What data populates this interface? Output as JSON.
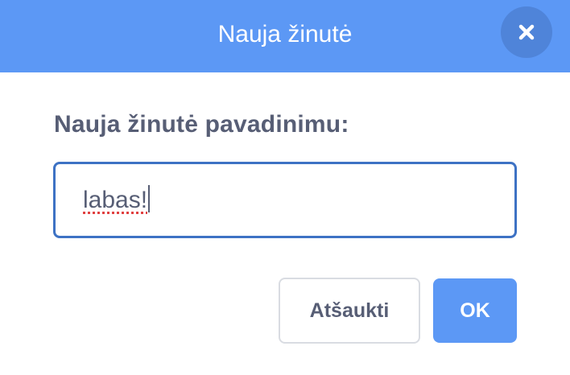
{
  "dialog": {
    "title": "Nauja žinutė",
    "close_icon": "close-icon"
  },
  "form": {
    "label": "Nauja žinutė pavadinimu:",
    "input_value": "labas!"
  },
  "buttons": {
    "cancel_label": "Atšaukti",
    "ok_label": "OK"
  },
  "colors": {
    "header": "#5c98f5",
    "close_button": "#4f84d9",
    "input_border": "#3d72c4",
    "text": "#575e75",
    "ok_button": "#5c98f5"
  }
}
